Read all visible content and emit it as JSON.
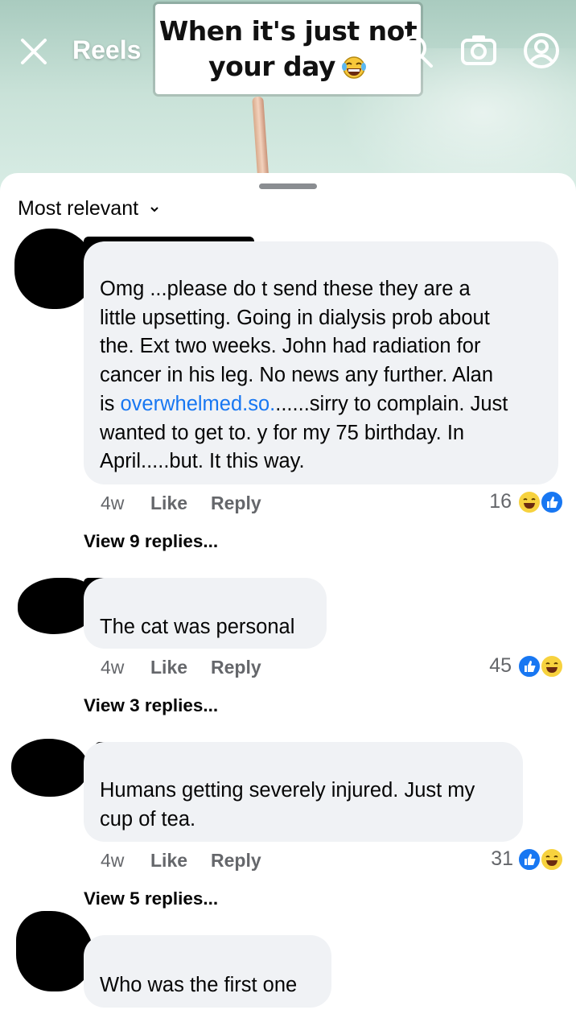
{
  "header": {
    "close_icon": "close-icon",
    "reels_label": "Reels",
    "dropdown_icon": "chevron-down-icon",
    "search_icon": "search-icon",
    "camera_icon": "camera-icon",
    "profile_icon": "profile-icon"
  },
  "video": {
    "caption_line1": "When it's just not",
    "caption_line2": "your day",
    "caption_emoji": "laughing-face-emoji"
  },
  "sheet": {
    "sort_label": "Most relevant",
    "sort_icon": "chevron-down-icon"
  },
  "comments": [
    {
      "author": "",
      "text_parts": [
        "Omg ...please do t send these they are a",
        "little upsetting. Going in dialysis prob about",
        "the. Ext two weeks. John had radiation for",
        "cancer in his leg. No news any further. Alan",
        "is ",
        "overwhelmed.so.",
        "......sirry to complain. Just",
        "wanted to get to. y for my 75 birthday. In",
        "April.....but. It this way."
      ],
      "time": "4w",
      "like_label": "Like",
      "reply_label": "Reply",
      "reaction_count": "16",
      "reactions": [
        "haha",
        "like"
      ],
      "view_replies": "View 9 replies..."
    },
    {
      "author": "",
      "text": "The cat was personal",
      "time": "4w",
      "like_label": "Like",
      "reply_label": "Reply",
      "reaction_count": "45",
      "reactions": [
        "like",
        "haha"
      ],
      "view_replies": "View 3 replies..."
    },
    {
      "author": "",
      "text_line1": "Humans getting severely injured. Just my",
      "text_line2": "cup of tea.",
      "time": "4w",
      "like_label": "Like",
      "reply_label": "Reply",
      "reaction_count": "31",
      "reactions": [
        "like",
        "haha"
      ],
      "view_replies": "View 5 replies..."
    },
    {
      "author": "",
      "text": "Who was the first one"
    }
  ],
  "colors": {
    "link": "#1877f2",
    "bubble": "#f0f2f5",
    "meta_text": "#65676b",
    "like_blue": "#1877f2",
    "haha_yellow": "#f7d23e"
  }
}
